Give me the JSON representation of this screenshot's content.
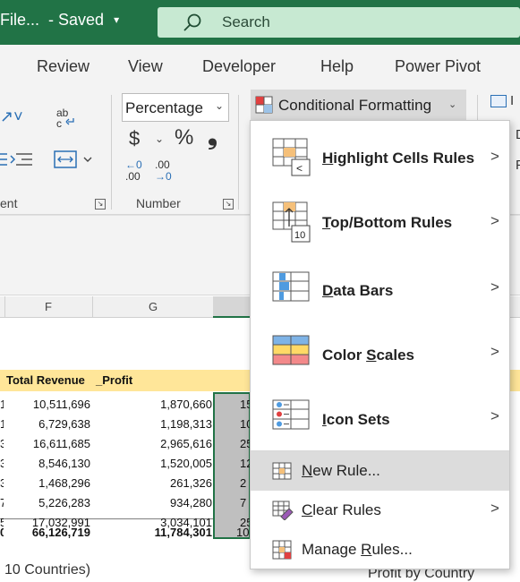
{
  "titlebar": {
    "doc": "File...",
    "saved": "- Saved",
    "chevron": "▾"
  },
  "search": {
    "placeholder": "Search"
  },
  "tabs": [
    "Review",
    "View",
    "Developer",
    "Help",
    "Power Pivot"
  ],
  "ribbon": {
    "alignment_label": "ent",
    "number_label": "Number",
    "number_format": "Percentage",
    "currency": "$",
    "percent": "%",
    "comma": "❟",
    "inc_decimal_a": "←0",
    "inc_decimal_b": ".00",
    "dec_decimal_a": ".00",
    "dec_decimal_b": "→0",
    "cf_label": "Conditional Formatting",
    "right_edge_a": "I",
    "right_edge_b": "D",
    "right_edge_c": "F"
  },
  "columns": {
    "f": "F",
    "g": "G"
  },
  "sheet": {
    "headers": {
      "revenue": "Total Revenue",
      "profit": "_Profit"
    },
    "rows": [
      {
        "lead": "1",
        "revenue": "10,511,696",
        "profit": "1,870,660",
        "h": "15"
      },
      {
        "lead": "1",
        "revenue": "6,729,638",
        "profit": "1,198,313",
        "h": "10"
      },
      {
        "lead": "3",
        "revenue": "16,611,685",
        "profit": "2,965,616",
        "h": "25"
      },
      {
        "lead": "3",
        "revenue": "8,546,130",
        "profit": "1,520,005",
        "h": "12"
      },
      {
        "lead": "3",
        "revenue": "1,468,296",
        "profit": "261,326",
        "h": "2"
      },
      {
        "lead": "7",
        "revenue": "5,226,283",
        "profit": "934,280",
        "h": "7"
      },
      {
        "lead": "5",
        "revenue": "17,032,991",
        "profit": "3,034,101",
        "h": "25"
      }
    ],
    "total": {
      "lead": "0",
      "revenue": "66,126,719",
      "profit": "11,784,301",
      "h": "10"
    },
    "footer_left": "10 Countries)",
    "footer_right": "Profit by Country"
  },
  "menu": {
    "items": [
      {
        "pre": "",
        "u": "H",
        "post": "ighlight Cells Rules",
        "icon": "highlight-cells-icon"
      },
      {
        "pre": "",
        "u": "T",
        "post": "op/Bottom Rules",
        "icon": "top-bottom-icon"
      },
      {
        "pre": "",
        "u": "D",
        "post": "ata Bars",
        "icon": "data-bars-icon"
      },
      {
        "pre": "Color ",
        "u": "S",
        "post": "cales",
        "icon": "color-scales-icon"
      },
      {
        "pre": "",
        "u": "I",
        "post": "con Sets",
        "icon": "icon-sets-icon"
      },
      {
        "pre": "",
        "u": "N",
        "post": "ew Rule...",
        "icon": "new-rule-icon"
      },
      {
        "pre": "",
        "u": "C",
        "post": "lear Rules",
        "icon": "clear-rules-icon"
      },
      {
        "pre": "Manage ",
        "u": "R",
        "post": "ules...",
        "icon": "manage-rules-icon"
      }
    ],
    "submenu_arrow": ">"
  }
}
